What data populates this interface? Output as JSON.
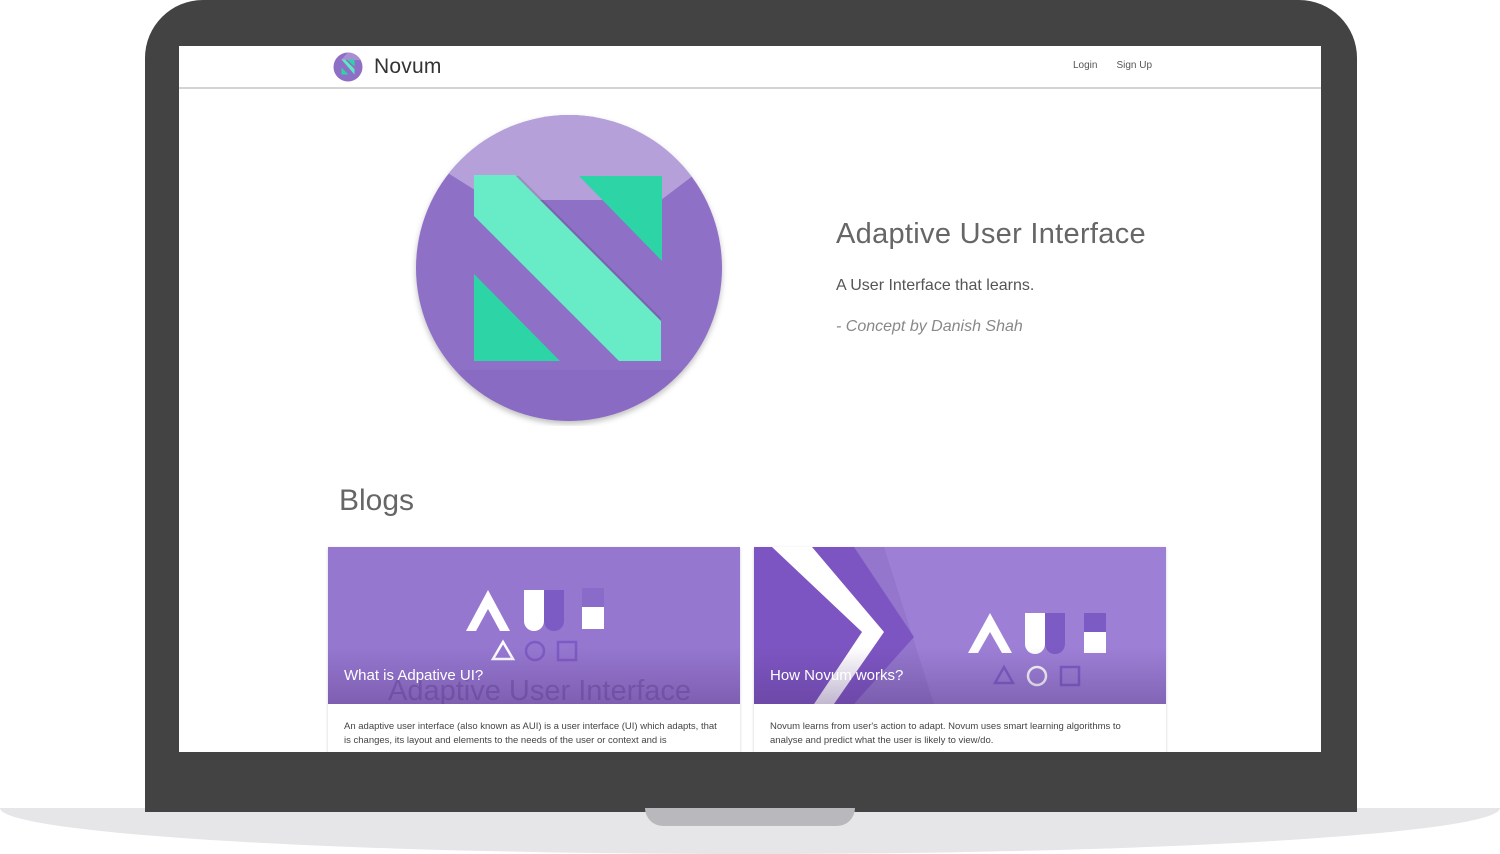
{
  "navbar": {
    "brand": "Novum",
    "links": [
      "Login",
      "Sign Up"
    ]
  },
  "hero": {
    "title": "Adaptive User Interface",
    "subtitle": "A User Interface that learns.",
    "credit": "- Concept by Danish Shah"
  },
  "blogs": {
    "heading": "Blogs",
    "cards": [
      {
        "title": "What is Adpative UI?",
        "watermark": "Adaptive User Interface",
        "body": "An adaptive user interface (also known as AUI) is a user interface (UI) which adapts, that is changes, its layout and elements to the needs of the user or context and is"
      },
      {
        "title": "How Novum works?",
        "body": "Novum learns from user's action to adapt. Novum uses smart learning algorithms to analyse and predict what the user is likely to view/do."
      }
    ]
  },
  "colors": {
    "brand_purple": "#8e6fc6",
    "brand_mint": "#5ee8c4",
    "laptop_frame": "#434343"
  }
}
